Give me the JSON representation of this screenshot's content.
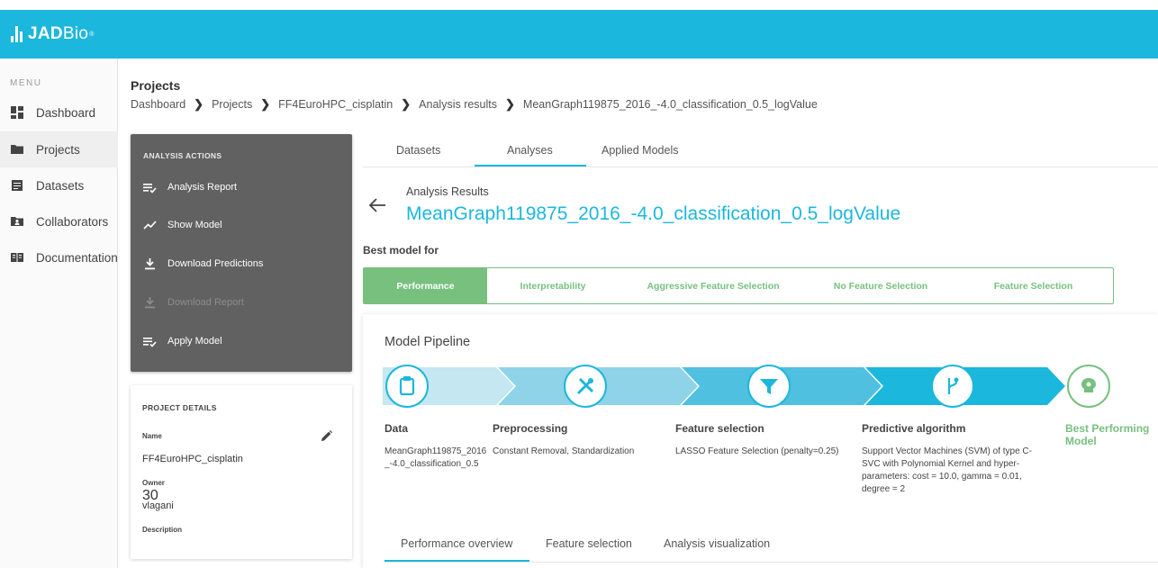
{
  "app": {
    "logo_text": "JAD",
    "logo_text2": "Bio",
    "logo_mark": "®"
  },
  "sidebar": {
    "menu_title": "MENU",
    "items": [
      {
        "label": "Dashboard",
        "icon": "dashboard-icon"
      },
      {
        "label": "Projects",
        "icon": "folder-icon",
        "active": true
      },
      {
        "label": "Datasets",
        "icon": "dataset-icon"
      },
      {
        "label": "Collaborators",
        "icon": "collaborators-icon"
      },
      {
        "label": "Documentation",
        "icon": "book-icon"
      }
    ]
  },
  "page": {
    "title": "Projects",
    "breadcrumb": [
      "Dashboard",
      "Projects",
      "FF4EuroHPC_cisplatin",
      "Analysis results",
      "MeanGraph119875_2016_-4.0_classification_0.5_logValue"
    ]
  },
  "actions": {
    "title": "ANALYSIS ACTIONS",
    "items": [
      {
        "label": "Analysis Report",
        "icon": "report-icon",
        "enabled": true
      },
      {
        "label": "Show Model",
        "icon": "trend-icon",
        "enabled": true
      },
      {
        "label": "Download Predictions",
        "icon": "download-icon",
        "enabled": true
      },
      {
        "label": "Download Report",
        "icon": "download-icon",
        "enabled": false
      },
      {
        "label": "Apply Model",
        "icon": "apply-icon",
        "enabled": true
      }
    ]
  },
  "project_details": {
    "title": "PROJECT DETAILS",
    "name_label": "Name",
    "name_value": "FF4EuroHPC_cisplatin",
    "owner_label": "Owner",
    "owner_value": "vlagani",
    "owner_number": "30",
    "description_label": "Description"
  },
  "top_tabs": [
    "Datasets",
    "Analyses",
    "Applied Models"
  ],
  "top_tabs_active": "Analyses",
  "analysis": {
    "label": "Analysis Results",
    "title": "MeanGraph119875_2016_-4.0_classification_0.5_logValue",
    "best_model_for": "Best model for"
  },
  "model_tabs": [
    "Performance",
    "Interpretability",
    "Aggressive Feature Selection",
    "No Feature Selection",
    "Feature Selection"
  ],
  "model_tabs_active": "Performance",
  "pipeline": {
    "title": "Model Pipeline",
    "stages": [
      {
        "name": "Data",
        "desc": "MeanGraph119875_2016_-4.0_classification_0.5",
        "icon": "clipboard-icon"
      },
      {
        "name": "Preprocessing",
        "desc": "Constant Removal, Standardization",
        "icon": "tools-icon"
      },
      {
        "name": "Feature selection",
        "desc": "LASSO Feature Selection (penalty=0.25)",
        "icon": "filter-icon"
      },
      {
        "name": "Predictive algorithm",
        "desc": "Support Vector Machines (SVM) of type C-SVC with Polynomial Kernel and hyper-parameters: cost = 10.0, gamma = 0.01, degree = 2",
        "icon": "branch-icon"
      }
    ],
    "best": {
      "name": "Best Performing Model",
      "icon": "brain-icon"
    }
  },
  "bottom_tabs": [
    "Performance overview",
    "Feature selection",
    "Analysis visualization"
  ],
  "bottom_tabs_active": "Performance overview",
  "colors": {
    "brand": "#1cb7dc",
    "green": "#77c07e",
    "panel": "#616161"
  }
}
